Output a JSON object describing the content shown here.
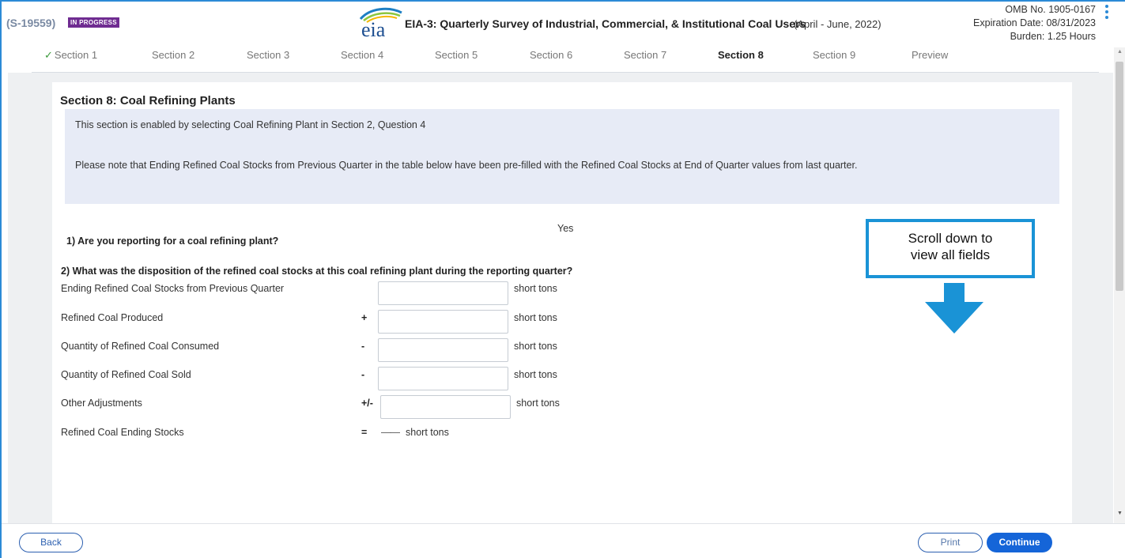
{
  "header": {
    "survey_id": "(S-19559)",
    "status_badge": "IN PROGRESS",
    "logo_text": "eia",
    "title": "EIA-3: Quarterly Survey of Industrial, Commercial, & Institutional Coal Users",
    "period": "(April - June, 2022)",
    "omb_number": "OMB No. 1905-0167",
    "expiration": "Expiration Date: 08/31/2023",
    "burden": "Burden: 1.25 Hours",
    "menu_icon": "kebab-menu-icon"
  },
  "tabs": [
    {
      "label": "Section 1",
      "completed": true,
      "active": false
    },
    {
      "label": "Section 2",
      "completed": false,
      "active": false
    },
    {
      "label": "Section 3",
      "completed": false,
      "active": false
    },
    {
      "label": "Section 4",
      "completed": false,
      "active": false
    },
    {
      "label": "Section 5",
      "completed": false,
      "active": false
    },
    {
      "label": "Section 6",
      "completed": false,
      "active": false
    },
    {
      "label": "Section 7",
      "completed": false,
      "active": false
    },
    {
      "label": "Section 8",
      "completed": false,
      "active": true
    },
    {
      "label": "Section 9",
      "completed": false,
      "active": false
    },
    {
      "label": "Preview",
      "completed": false,
      "active": false
    }
  ],
  "section": {
    "title": "Section 8: Coal Refining Plants",
    "notice_line1": "This section is enabled by selecting Coal Refining Plant in Section 2, Question 4",
    "notice_line2": "Please note that Ending Refined Coal Stocks from Previous Quarter in the table below have been pre-filled with the Refined Coal Stocks at End of Quarter values from last quarter."
  },
  "question1": {
    "text": "1) Are you reporting for a coal refining plant?",
    "answer": "Yes"
  },
  "question2": {
    "text": "2) What was the disposition of the refined coal stocks at this coal refining plant during the reporting quarter?",
    "rows": [
      {
        "label": "Ending Refined Coal Stocks from Previous Quarter",
        "operator": "",
        "value": "",
        "unit": "short tons"
      },
      {
        "label": "Refined Coal Produced",
        "operator": "+",
        "value": "",
        "unit": "short tons"
      },
      {
        "label": "Quantity of Refined Coal Consumed",
        "operator": "-",
        "value": "",
        "unit": "short tons"
      },
      {
        "label": "Quantity of Refined Coal Sold",
        "operator": "-",
        "value": "",
        "unit": "short tons"
      },
      {
        "label": "Other Adjustments",
        "operator": "+/-",
        "value": "",
        "unit": "short tons"
      }
    ],
    "total": {
      "label": "Refined Coal Ending Stocks",
      "operator": "=",
      "value": "——",
      "unit": "short tons"
    }
  },
  "callout": {
    "text_line1": "Scroll down to",
    "text_line2": "view all fields",
    "arrow_icon": "arrow-down-icon",
    "color": "#1a93d6"
  },
  "footer": {
    "back_label": "Back",
    "print_label": "Print",
    "continue_label": "Continue"
  },
  "colors": {
    "accent": "#2b8ad6",
    "badge": "#6f2c91",
    "primary_button": "#1565d8",
    "notice_bg": "#e7ebf6",
    "check": "#3a9a3a"
  }
}
